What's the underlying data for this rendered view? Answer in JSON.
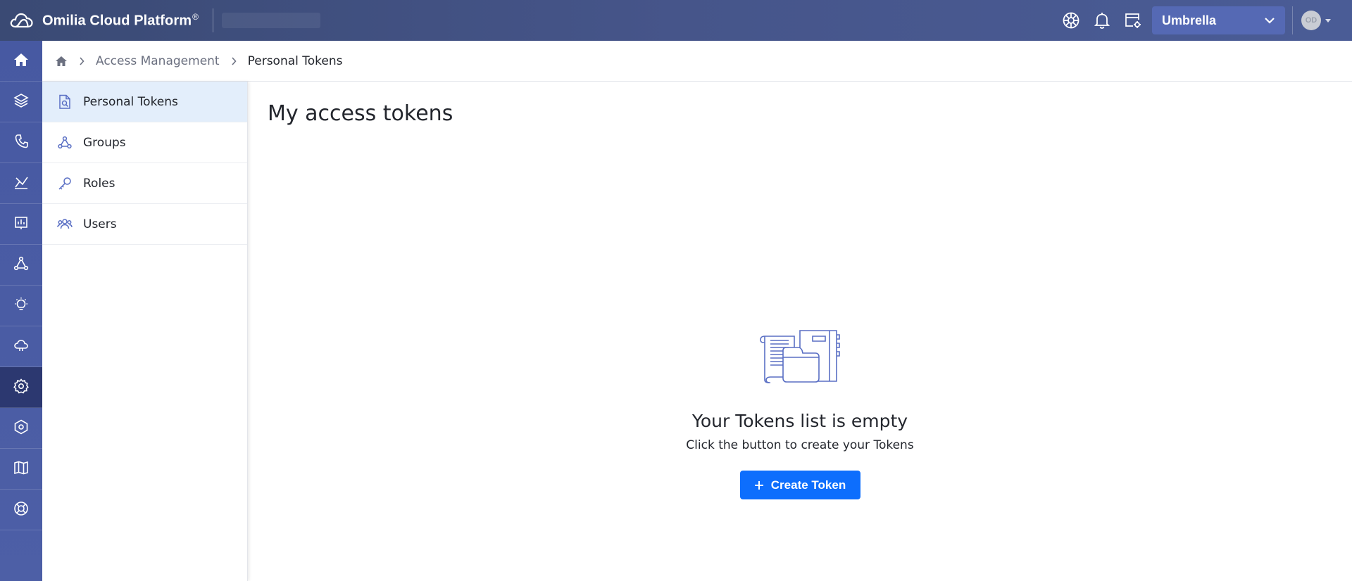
{
  "header": {
    "brand": "Omilia Cloud Platform",
    "brand_mark": "®",
    "org_selected": "Umbrella",
    "avatar_initials": "OD",
    "icons": [
      "settings-wheel-icon",
      "bell-icon",
      "calendar-settings-icon"
    ]
  },
  "rail": {
    "items": [
      {
        "icon": "home-icon"
      },
      {
        "icon": "layers-icon"
      },
      {
        "icon": "phone-icon"
      },
      {
        "icon": "analytics-icon"
      },
      {
        "icon": "reports-icon"
      },
      {
        "icon": "network-icon"
      },
      {
        "icon": "lightbulb-icon"
      },
      {
        "icon": "cloud-icon"
      },
      {
        "icon": "gear-icon",
        "active": true
      },
      {
        "icon": "hex-gear-icon"
      },
      {
        "icon": "map-icon"
      },
      {
        "icon": "help-icon"
      }
    ]
  },
  "breadcrumb": {
    "section": "Access Management",
    "current": "Personal Tokens"
  },
  "subnav": {
    "items": [
      {
        "label": "Personal Tokens",
        "icon": "token-icon",
        "active": true
      },
      {
        "label": "Groups",
        "icon": "groups-icon"
      },
      {
        "label": "Roles",
        "icon": "key-icon"
      },
      {
        "label": "Users",
        "icon": "users-icon"
      }
    ]
  },
  "main": {
    "title": "My access tokens",
    "empty_title": "Your Tokens list is empty",
    "empty_subtitle": "Click the button to create your Tokens",
    "create_button": "Create Token"
  },
  "colors": {
    "topbar": "#3a4a74",
    "rail": "#4759a2",
    "rail_active": "#2c3870",
    "org_select": "#5569b4",
    "subnav_active": "#e3eefb",
    "primary_button": "#0d6efd",
    "icon_accent": "#5a6fc4"
  }
}
